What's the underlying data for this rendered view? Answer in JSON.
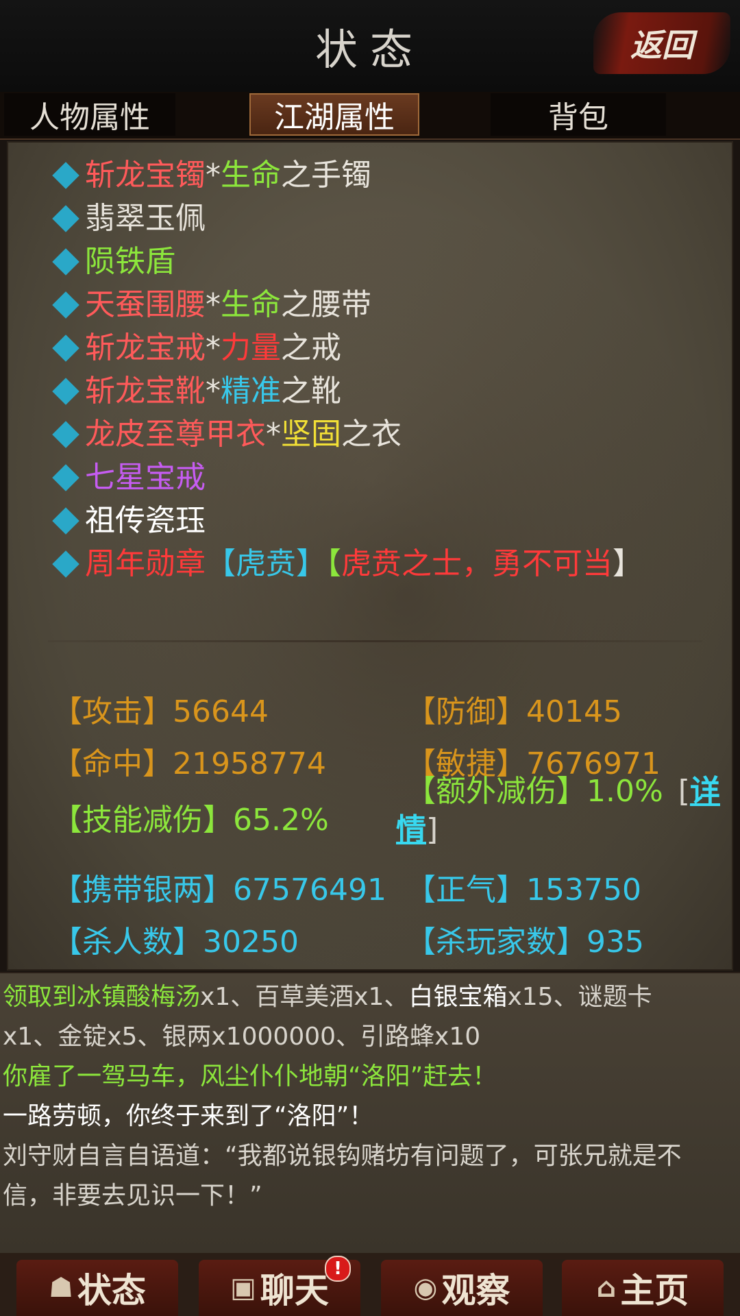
{
  "colors": {
    "red": "#ff5a5a",
    "green": "#8ce63c",
    "white": "#e8e4dc",
    "cyan": "#38c8ea",
    "yellow": "#f2e036",
    "purple": "#c65cf2",
    "orange": "#d9951c",
    "diamond": "#2aa8c8"
  },
  "header": {
    "title": "状态",
    "back_label": "返回"
  },
  "tabs": [
    {
      "label": "人物属性"
    },
    {
      "label": "江湖属性"
    },
    {
      "label": "背包"
    }
  ],
  "equipment": [
    {
      "parts": [
        {
          "text": "斩龙宝镯",
          "color": "#ff5a5a"
        },
        {
          "text": "*",
          "color": "#e8e4dc"
        },
        {
          "text": "生命",
          "color": "#8ce63c"
        },
        {
          "text": "之手镯",
          "color": "#e8e4dc"
        }
      ]
    },
    {
      "parts": [
        {
          "text": "翡翠玉佩",
          "color": "#e8e4dc"
        }
      ]
    },
    {
      "parts": [
        {
          "text": "陨铁盾",
          "color": "#8ce63c"
        }
      ]
    },
    {
      "parts": [
        {
          "text": "天蚕围腰",
          "color": "#ff5a5a"
        },
        {
          "text": "*",
          "color": "#e8e4dc"
        },
        {
          "text": "生命",
          "color": "#8ce63c"
        },
        {
          "text": "之腰带",
          "color": "#e8e4dc"
        }
      ]
    },
    {
      "parts": [
        {
          "text": "斩龙宝戒",
          "color": "#ff5a5a"
        },
        {
          "text": "*",
          "color": "#e8e4dc"
        },
        {
          "text": "力量",
          "color": "#ff3a3a"
        },
        {
          "text": "之戒",
          "color": "#e8e4dc"
        }
      ]
    },
    {
      "parts": [
        {
          "text": "斩龙宝靴",
          "color": "#ff5a5a"
        },
        {
          "text": "*",
          "color": "#e8e4dc"
        },
        {
          "text": "精准",
          "color": "#38c8ea"
        },
        {
          "text": "之靴",
          "color": "#e8e4dc"
        }
      ]
    },
    {
      "parts": [
        {
          "text": "龙皮至尊甲衣",
          "color": "#ff5a5a"
        },
        {
          "text": "*",
          "color": "#e8e4dc"
        },
        {
          "text": "坚固",
          "color": "#f2e036"
        },
        {
          "text": "之衣",
          "color": "#e8e4dc"
        }
      ]
    },
    {
      "parts": [
        {
          "text": "七星宝戒",
          "color": "#c65cf2"
        }
      ]
    },
    {
      "parts": [
        {
          "text": "祖传瓷珏",
          "color": "#ffffff"
        }
      ]
    },
    {
      "parts": [
        {
          "text": "周年勋章",
          "color": "#ff3a3a"
        },
        {
          "text": "【虎贲】",
          "color": "#38c8ea"
        },
        {
          "text": "【",
          "color": "#8ce63c"
        },
        {
          "text": "虎贲之士，勇不可当",
          "color": "#ff3a3a"
        },
        {
          "text": "】",
          "color": "#e8e4dc"
        }
      ]
    }
  ],
  "stats": {
    "attack_label": "【攻击】",
    "attack_value": "56644",
    "defense_label": "【防御】",
    "defense_value": "40145",
    "hit_label": "【命中】",
    "hit_value": "21958774",
    "agility_label": "【敏捷】",
    "agility_value": "7676971",
    "skill_reduce_label": "【技能减伤】",
    "skill_reduce_value": "65.2%",
    "extra_reduce_label": "【额外减伤】",
    "extra_reduce_value": "1.0%",
    "detail_open": "[",
    "detail_link_1": "详",
    "detail_link_2": "情",
    "detail_close": "]",
    "silver_label": "【携带银两】",
    "silver_value": "67576491",
    "righteous_label": "【正气】",
    "righteous_value": "153750",
    "kills_label": "【杀人数】",
    "kills_value": "30250",
    "player_kills_label": "【杀玩家数】",
    "player_kills_value": "935"
  },
  "log": {
    "line1": [
      {
        "text": "领取到冰镇酸梅汤",
        "color": "#8ce63c"
      },
      {
        "text": "x1、百草美酒x1、",
        "color": "#d8d4cc"
      },
      {
        "text": "白银宝箱",
        "color": "#ffffff"
      },
      {
        "text": "x15、谜题卡",
        "color": "#d8d4cc"
      }
    ],
    "line2": "x1、金锭x5、银两x1000000、引路蜂x10",
    "line3": "你雇了一驾马车，风尘仆仆地朝“洛阳”赶去！",
    "line4": "一路劳顿，你终于来到了“洛阳”！",
    "line5": "刘守财自言自语道：“我都说银钩赌坊有问题了，可张兄就是不",
    "line6": "信，非要去见识一下！”"
  },
  "nav": [
    {
      "label": "状态",
      "icon": "person-icon"
    },
    {
      "label": "聊天",
      "icon": "chat-icon",
      "badge": "!"
    },
    {
      "label": "观察",
      "icon": "eye-icon"
    },
    {
      "label": "主页",
      "icon": "home-icon"
    }
  ]
}
